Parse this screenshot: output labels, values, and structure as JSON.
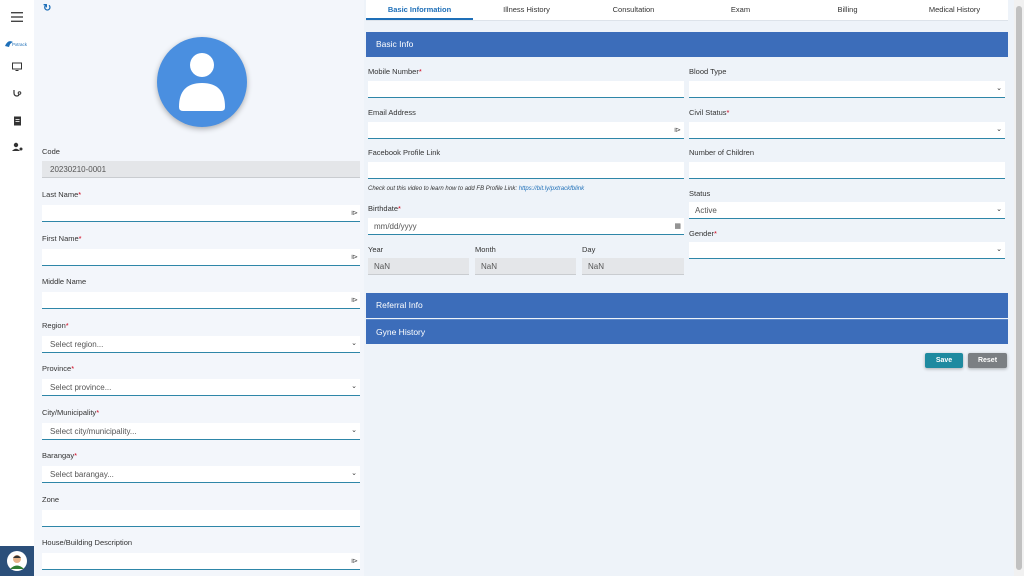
{
  "sidebar": {
    "icons": [
      "menu-icon",
      "monitor-icon",
      "stethoscope-icon",
      "document-icon",
      "user-settings-icon"
    ],
    "logo_text": "Pxtrack"
  },
  "patient": {
    "code_label": "Code",
    "code_value": "20230210-0001",
    "last_name_label": "Last Name",
    "first_name_label": "First Name",
    "middle_name_label": "Middle Name",
    "region_label": "Region",
    "region_value": "Select region...",
    "province_label": "Province",
    "province_value": "Select province...",
    "city_label": "City/Municipality",
    "city_value": "Select city/municipality...",
    "barangay_label": "Barangay",
    "barangay_value": "Select barangay...",
    "zone_label": "Zone",
    "house_label": "House/Building Description"
  },
  "tabs": [
    "Basic Information",
    "Illness History",
    "Consultation",
    "Exam",
    "Billing",
    "Medical History"
  ],
  "basic": {
    "header": "Basic Info",
    "mobile_label": "Mobile Number",
    "email_label": "Email Address",
    "facebook_label": "Facebook Profile Link",
    "fb_hint": "Check out this video to learn how to add FB Profile Link:",
    "fb_hint_link": "https://bit.ly/pxtrackfblink",
    "birthdate_label": "Birthdate",
    "birthdate_placeholder": "mm/dd/yyyy",
    "year_label": "Year",
    "year_value": "NaN",
    "month_label": "Month",
    "month_value": "NaN",
    "day_label": "Day",
    "day_value": "NaN",
    "blood_type_label": "Blood Type",
    "civil_status_label": "Civil Status",
    "children_label": "Number of Children",
    "status_label": "Status",
    "status_value": "Active",
    "gender_label": "Gender"
  },
  "sections": [
    "Referral Info",
    "Gyne History"
  ],
  "actions": {
    "save": "Save",
    "reset": "Reset"
  },
  "colors": {
    "section": "#3c6dba",
    "save": "#1e8aa0",
    "reset": "#7b7f83",
    "accent": "#1e6fb8"
  }
}
